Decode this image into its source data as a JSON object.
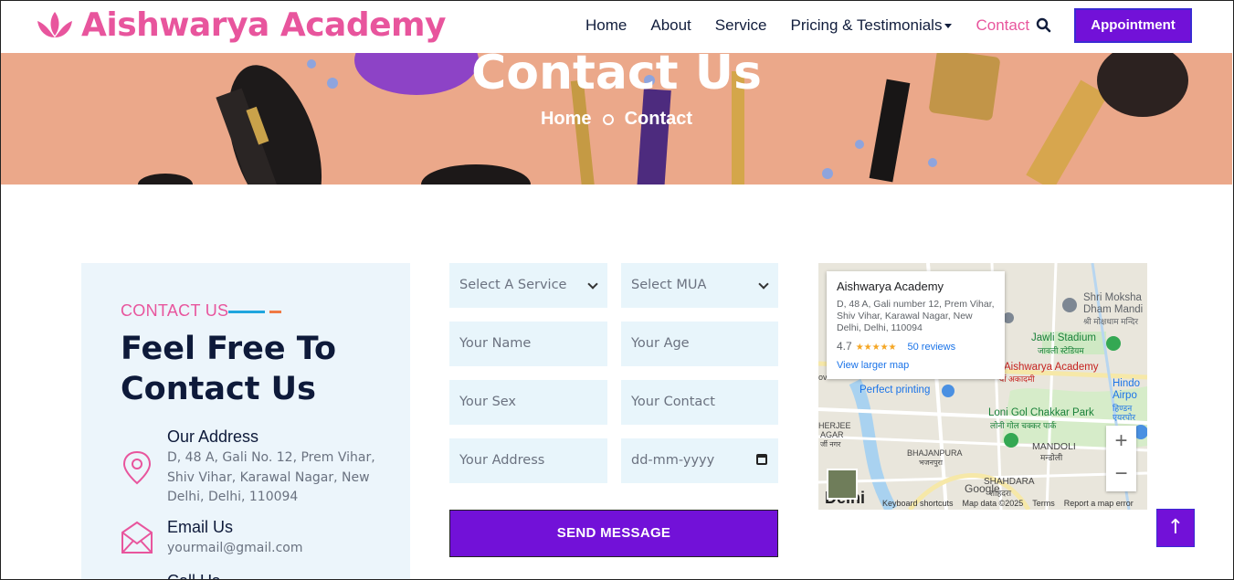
{
  "header": {
    "logo_text": "Aishwarya Academy",
    "nav": [
      "Home",
      "About",
      "Service",
      "Pricing & Testimonials",
      "Contact"
    ],
    "appointment_label": "Appointment",
    "brand_color": "#e8559d",
    "accent_color": "#7211d8"
  },
  "banner": {
    "title": "Contact Us",
    "breadcrumb_home": "Home",
    "breadcrumb_current": "Contact"
  },
  "info": {
    "kicker": "CONTACT US",
    "headline_line1": "Feel Free To",
    "headline_line2": "Contact Us",
    "address_title": "Our Address",
    "address_text": "D, 48 A, Gali No. 12, Prem Vihar, Shiv Vihar, Karawal Nagar, New Delhi, Delhi, 110094",
    "email_title": "Email Us",
    "email_text": "yourmail@gmail.com",
    "call_title": "Call Us"
  },
  "form": {
    "service_select": "Select A Service",
    "mua_select": "Select MUA",
    "name_placeholder": "Your Name",
    "age_placeholder": "Your Age",
    "sex_placeholder": "Your Sex",
    "contact_placeholder": "Your Contact",
    "address_placeholder": "Your Address",
    "date_placeholder": "dd-mm-yyyy",
    "send_label": "SEND MESSAGE"
  },
  "map": {
    "place_name": "Aishwarya Academy",
    "place_address": "D, 48 A, Gali number 12, Prem Vihar, Shiv Vihar, Karawal Nagar, New Delhi, Delhi, 110094",
    "rating": "4.7",
    "stars": "★★★★★",
    "reviews": "50 reviews",
    "larger_map": "View larger map",
    "labels": {
      "shri": "Shri Moksha",
      "dham": "Dham Mandi",
      "shri_hi": "श्री मोक्षधाम मन्दिर",
      "jawli": "Jawli Stadium",
      "jawli_hi": "जावली स्टेडियम",
      "aish": "Aishwarya Academy",
      "aish_hi": "र्या अकादमी",
      "perfect": "Perfect printing",
      "hindon1": "Hindo",
      "hindon2": "Airpo",
      "hindon3": "हिण्डन",
      "hindon4": "एयरपोर",
      "loni": "Loni Gol Chakkar Park",
      "loni_hi": "लोनी गोल चक्कर पार्क",
      "mandoli": "MANDOLI",
      "mandoli_hi": "मन्डोली",
      "bhajan": "BHAJANPURA",
      "bhajan_hi": "भजनपुरा",
      "shahdara": "SHAHDARA",
      "shahdara_hi": "शाहदरा",
      "kherjee": "HERJEE",
      "agar": "AGAR",
      "agar_hi": "र्जी नगर",
      "delhi": "Delhi",
      "ov": "ov"
    },
    "google": "Google",
    "attrib": [
      "Keyboard shortcuts",
      "Map data ©2025",
      "Terms",
      "Report a map error"
    ],
    "zoom_in": "+",
    "zoom_out": "−"
  },
  "totop": "↑"
}
